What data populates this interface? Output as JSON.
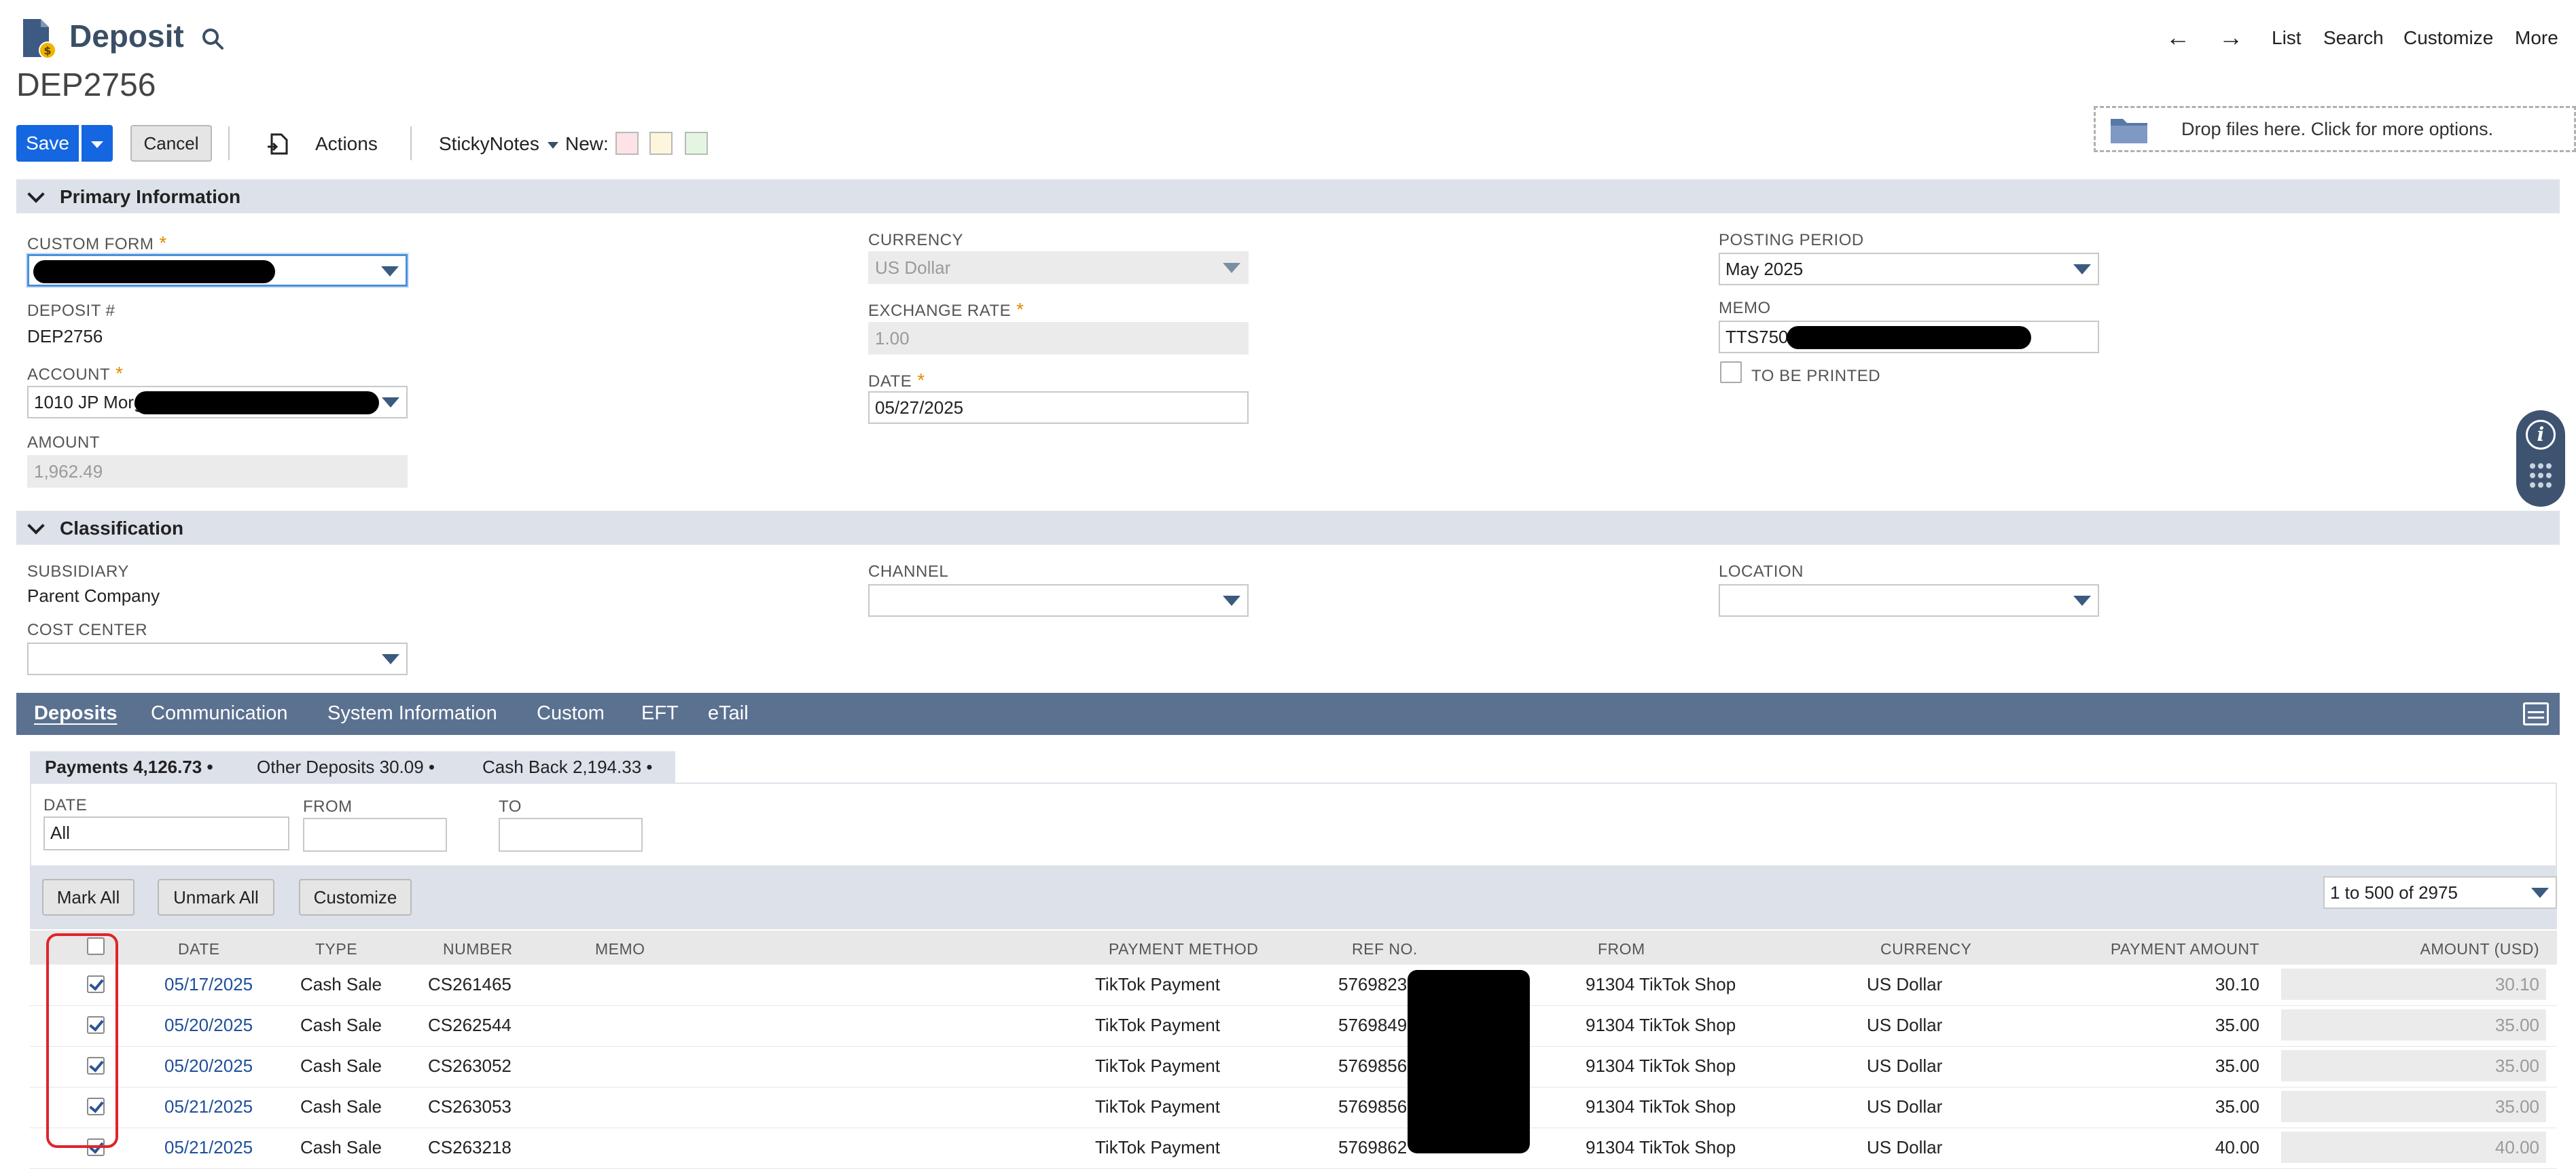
{
  "header": {
    "page_title": "Deposit",
    "record_id": "DEP2756",
    "nav_links": [
      "List",
      "Search",
      "Customize",
      "More"
    ]
  },
  "toolbar": {
    "save": "Save",
    "cancel": "Cancel",
    "actions": "Actions",
    "sticky_notes": "StickyNotes",
    "new_label": "New:",
    "note_colors": [
      "#fde2e6",
      "#fdf6dc",
      "#e4f6e2"
    ],
    "dropzone": "Drop files here. Click for more options."
  },
  "primary": {
    "section_title": "Primary Information",
    "custom_form_label": "CUSTOM FORM",
    "deposit_no_label": "DEPOSIT #",
    "deposit_no": "DEP2756",
    "account_label": "ACCOUNT",
    "account_value": "1010 JP Morg",
    "amount_label": "AMOUNT",
    "amount_value": "1,962.49",
    "currency_label": "CURRENCY",
    "currency_value": "US Dollar",
    "exchange_label": "EXCHANGE RATE",
    "exchange_value": "1.00",
    "date_label": "DATE",
    "date_value": "05/27/2025",
    "posting_label": "POSTING PERIOD",
    "posting_value": "May 2025",
    "memo_label": "MEMO",
    "memo_value": "TTS7508",
    "to_be_printed": "TO BE PRINTED"
  },
  "classification": {
    "section_title": "Classification",
    "subsidiary_label": "SUBSIDIARY",
    "subsidiary_value": "Parent Company",
    "cost_center_label": "COST CENTER",
    "channel_label": "CHANNEL",
    "location_label": "LOCATION"
  },
  "tabs": [
    "Deposits",
    "Communication",
    "System Information",
    "Custom",
    "EFT",
    "eTail"
  ],
  "subtabs": [
    "Payments 4,126.73 •",
    "Other Deposits 30.09 •",
    "Cash Back 2,194.33 •"
  ],
  "filters": {
    "date_label": "DATE",
    "date_value": "All",
    "from_label": "FROM",
    "to_label": "TO"
  },
  "list_buttons": {
    "mark_all": "Mark All",
    "unmark_all": "Unmark All",
    "customize": "Customize",
    "pager": "1 to 500 of 2975"
  },
  "columns": [
    "DATE",
    "TYPE",
    "NUMBER",
    "MEMO",
    "PAYMENT METHOD",
    "REF NO.",
    "FROM",
    "CURRENCY",
    "PAYMENT AMOUNT",
    "AMOUNT (USD)"
  ],
  "rows": [
    {
      "date": "05/17/2025",
      "type": "Cash Sale",
      "number": "CS261465",
      "method": "TikTok Payment",
      "ref": "5769823",
      "from": "91304 TikTok Shop",
      "currency": "US Dollar",
      "payment": "30.10",
      "usd": "30.10"
    },
    {
      "date": "05/20/2025",
      "type": "Cash Sale",
      "number": "CS262544",
      "method": "TikTok Payment",
      "ref": "5769849",
      "from": "91304 TikTok Shop",
      "currency": "US Dollar",
      "payment": "35.00",
      "usd": "35.00"
    },
    {
      "date": "05/20/2025",
      "type": "Cash Sale",
      "number": "CS263052",
      "method": "TikTok Payment",
      "ref": "5769856",
      "from": "91304 TikTok Shop",
      "currency": "US Dollar",
      "payment": "35.00",
      "usd": "35.00"
    },
    {
      "date": "05/21/2025",
      "type": "Cash Sale",
      "number": "CS263053",
      "method": "TikTok Payment",
      "ref": "5769856",
      "from": "91304 TikTok Shop",
      "currency": "US Dollar",
      "payment": "35.00",
      "usd": "35.00"
    },
    {
      "date": "05/21/2025",
      "type": "Cash Sale",
      "number": "CS263218",
      "method": "TikTok Payment",
      "ref": "5769862",
      "from": "91304 TikTok Shop",
      "currency": "US Dollar",
      "payment": "40.00",
      "usd": "40.00"
    }
  ],
  "colors": {
    "primary_button": "#1467e0",
    "tab_bar": "#5b7190",
    "section_bar": "#dde2ea",
    "link": "#1f4f9c",
    "highlight_outline": "#e0242a"
  }
}
